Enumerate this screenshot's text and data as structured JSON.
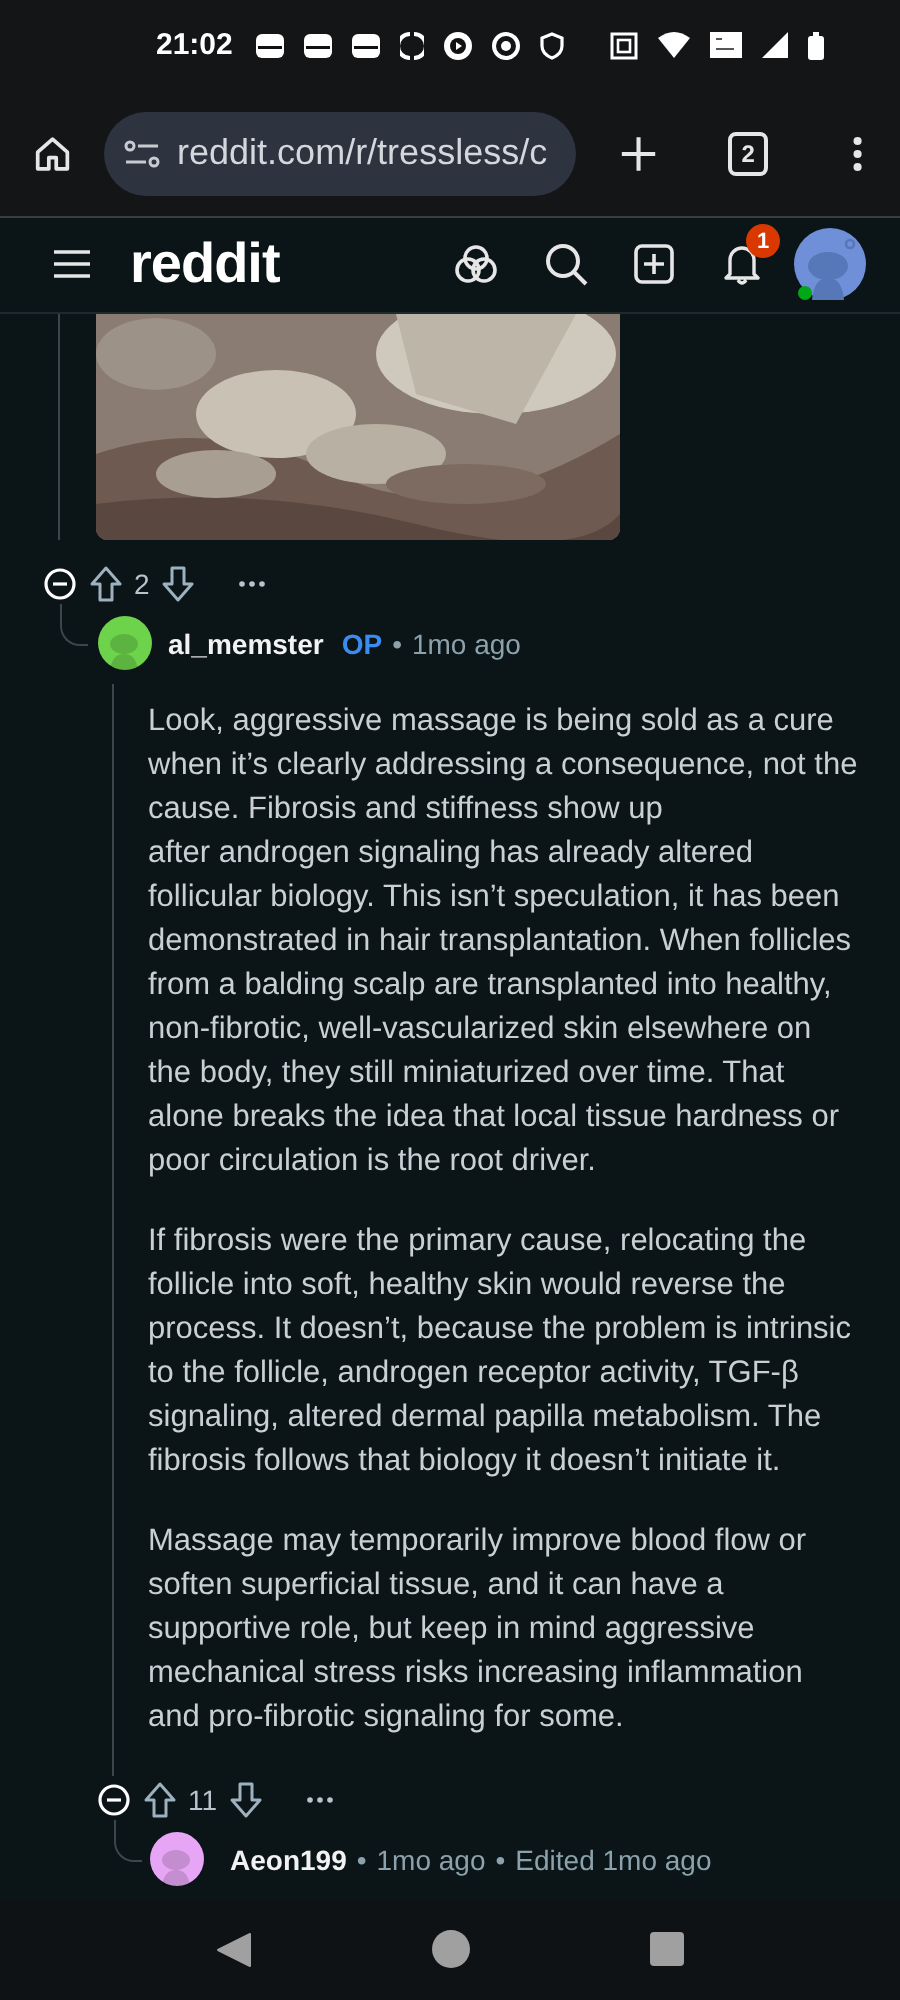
{
  "status_bar": {
    "time": "21:02"
  },
  "browser": {
    "url": "reddit.com/r/tressless/c",
    "tab_count": "2"
  },
  "header": {
    "logo": "reddit",
    "notification_count": "1",
    "online": true
  },
  "post_media": {
    "kind": "picture",
    "expanded": true,
    "score": "2"
  },
  "separator": "•",
  "comments": [
    {
      "author": "al_memster",
      "op_label": "OP",
      "time": "1mo ago",
      "color": "#6dd34a",
      "expanded": true,
      "score": "11",
      "paragraphs": [
        "Look, aggressive massage is being sold as a cure when it’s clearly addressing a consequence, not the cause. Fibrosis and stiffness show up\nafter androgen signaling has already altered follicular biology. This isn’t speculation, it has been demonstrated in hair transplantation. When follicles from a balding scalp are transplanted into healthy, non-fibrotic, well-vascularized skin elsewhere on the body, they still miniaturized over time. That alone breaks the idea that local tissue hardness or poor circulation is the root driver.",
        "If fibrosis were the primary cause, relocating the follicle into soft, healthy skin would reverse the process. It doesn’t, because the problem is intrinsic to the follicle, androgen receptor activity, TGF-β signaling, altered dermal papilla metabolism. The fibrosis follows that biology it doesn’t initiate it.",
        "Massage may temporarily improve blood flow or soften superficial tissue, and it can have a supportive role, but keep in mind aggressive mechanical stress risks increasing inflammation and pro-fibrotic signaling for some."
      ]
    },
    {
      "author": "Aeon199",
      "time": "1mo ago",
      "edited": "Edited 1mo ago",
      "color": "#e7a6f5"
    }
  ]
}
